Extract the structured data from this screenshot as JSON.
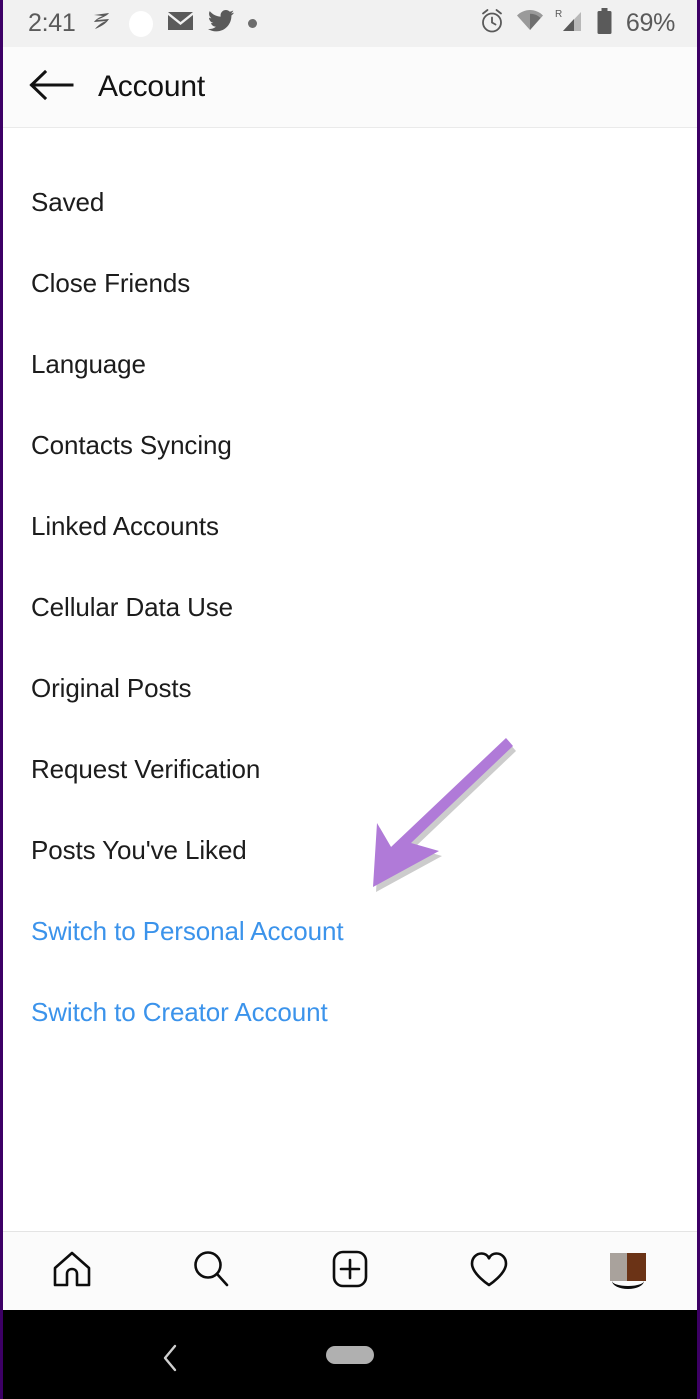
{
  "status_bar": {
    "time": "2:41",
    "battery_percent": "69%",
    "left_icons": [
      "zedge-z-icon",
      "white-circle-icon",
      "gmail-envelope-icon",
      "twitter-bird-icon",
      "more-notifications-dot-icon"
    ],
    "right_icons": [
      "alarm-clock-icon",
      "wifi-icon",
      "roaming-signal-icon",
      "battery-icon"
    ],
    "roaming_label": "R"
  },
  "header": {
    "title": "Account",
    "back_icon": "back-arrow-icon"
  },
  "menu": {
    "items": [
      {
        "label": "Saved",
        "style": "default"
      },
      {
        "label": "Close Friends",
        "style": "default"
      },
      {
        "label": "Language",
        "style": "default"
      },
      {
        "label": "Contacts Syncing",
        "style": "default"
      },
      {
        "label": "Linked Accounts",
        "style": "default"
      },
      {
        "label": "Cellular Data Use",
        "style": "default"
      },
      {
        "label": "Original Posts",
        "style": "default"
      },
      {
        "label": "Request Verification",
        "style": "default"
      },
      {
        "label": "Posts You've Liked",
        "style": "default"
      },
      {
        "label": "Switch to Personal Account",
        "style": "link"
      },
      {
        "label": "Switch to Creator Account",
        "style": "link"
      }
    ]
  },
  "annotation": {
    "type": "arrow",
    "points_to": "Switch to Personal Account",
    "color": "#b07ad8"
  },
  "bottom_nav": {
    "items": [
      {
        "icon": "home-icon"
      },
      {
        "icon": "search-icon"
      },
      {
        "icon": "add-post-icon"
      },
      {
        "icon": "heart-activity-icon"
      },
      {
        "icon": "profile-avatar-icon"
      }
    ]
  },
  "android_nav": {
    "back_icon": "android-back-chevron-icon",
    "home_pill": "android-home-pill"
  },
  "colors": {
    "link_blue": "#3b93eb",
    "arrow_purple": "#b07ad8",
    "frame_purple": "#3d0066",
    "status_bg": "#f1f1f1"
  }
}
